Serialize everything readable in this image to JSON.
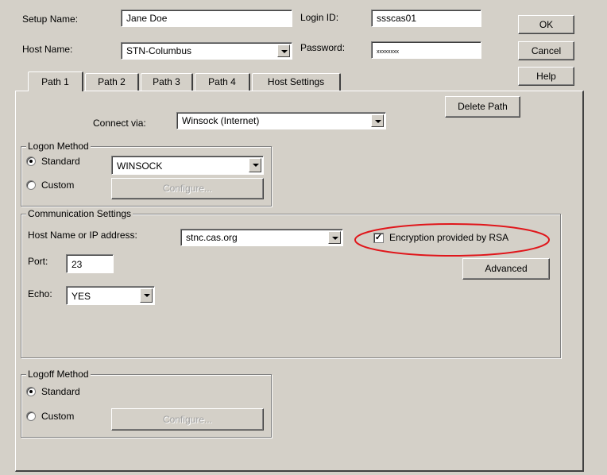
{
  "header": {
    "setup_name_label": "Setup Name:",
    "setup_name_value": "Jane Doe",
    "login_id_label": "Login ID:",
    "login_id_value": "ssscas01",
    "host_name_label": "Host Name:",
    "host_name_value": "STN-Columbus",
    "password_label": "Password:",
    "password_value": "xxxxxxxx"
  },
  "buttons": {
    "ok": "OK",
    "cancel": "Cancel",
    "help": "Help",
    "delete_path": "Delete Path",
    "advanced": "Advanced",
    "configure": "Configure..."
  },
  "tabs": [
    {
      "label": "Path 1",
      "active": true
    },
    {
      "label": "Path 2",
      "active": false
    },
    {
      "label": "Path 3",
      "active": false
    },
    {
      "label": "Path 4",
      "active": false
    },
    {
      "label": "Host Settings",
      "active": false
    }
  ],
  "path": {
    "connect_via_label": "Connect via:",
    "connect_via_value": "Winsock (Internet)"
  },
  "logon": {
    "title": "Logon Method",
    "standard_label": "Standard",
    "custom_label": "Custom",
    "selected": "Standard",
    "script_value": "WINSOCK"
  },
  "comm": {
    "title": "Communication Settings",
    "host_label": "Host Name or IP address:",
    "host_value": "stnc.cas.org",
    "port_label": "Port:",
    "port_value": "23",
    "echo_label": "Echo:",
    "echo_value": "YES",
    "encryption_label": "Encryption provided by RSA",
    "encryption_checked": true
  },
  "logoff": {
    "title": "Logoff Method",
    "standard_label": "Standard",
    "custom_label": "Custom",
    "selected": "Standard"
  },
  "colors": {
    "background": "#d4d0c8",
    "highlight_ellipse": "#e0161b"
  }
}
